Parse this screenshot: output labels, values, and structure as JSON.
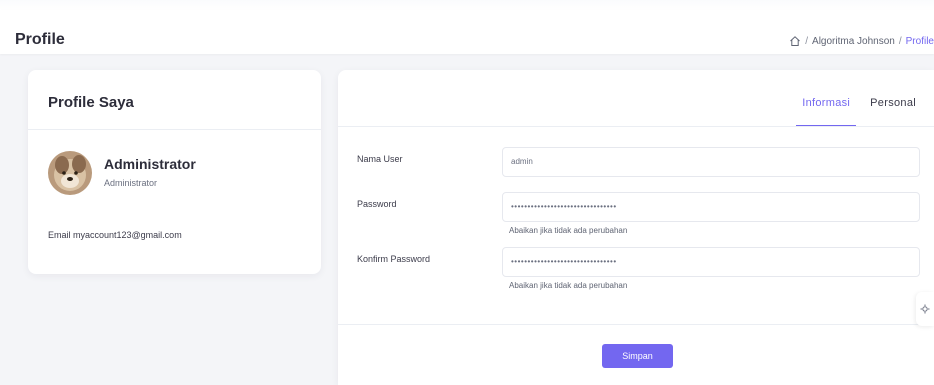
{
  "header": {
    "title": "Profile",
    "breadcrumb": {
      "home_icon": "home-icon",
      "separator": "/",
      "items": [
        "Algoritma Johnson",
        "Profile"
      ]
    }
  },
  "profile_card": {
    "title": "Profile Saya",
    "user": {
      "name": "Administrator",
      "role": "Administrator"
    },
    "email_line": "Email myaccount123@gmail.com"
  },
  "form_card": {
    "tabs": [
      {
        "label": "Informasi",
        "active": true
      },
      {
        "label": "Personal",
        "active": false
      }
    ],
    "fields": {
      "username": {
        "label": "Nama User",
        "value": "admin"
      },
      "password": {
        "label": "Password",
        "value": "••••••••••••••••••••••••••••••••",
        "hint": "Abaikan jika tidak ada perubahan"
      },
      "confirm_password": {
        "label": "Konfirm Password",
        "value": "••••••••••••••••••••••••••••••••",
        "hint": "Abaikan jika tidak ada perubahan"
      }
    },
    "save_label": "Simpan"
  },
  "colors": {
    "accent": "#7367f0",
    "background": "#f4f5f8",
    "card": "#ffffff"
  }
}
